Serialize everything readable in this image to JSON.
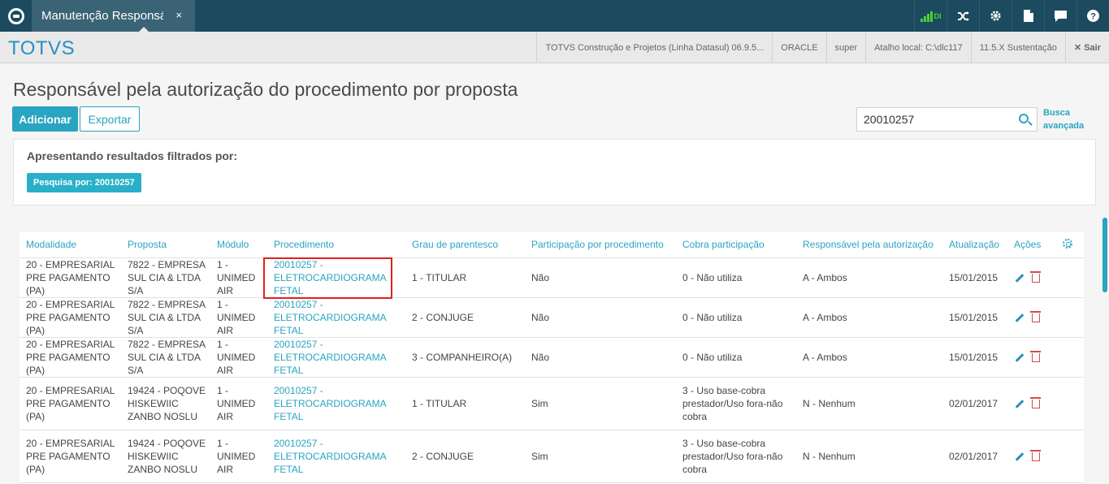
{
  "topbar": {
    "tab_label": "Manutenção Responsá",
    "tab_close": "×",
    "signal_label": "DI"
  },
  "header": {
    "brand": "TOTVS",
    "items": [
      "TOTVS Construção e Projetos (Linha Datasul) 06.9.5...",
      "ORACLE",
      "super",
      "Atalho local: C:\\dlc117",
      "11.5.X Sustentação"
    ],
    "logout": "✕ Sair"
  },
  "page": {
    "title": "Responsável pela autorização do procedimento por proposta",
    "add_label": "Adicionar",
    "export_label": "Exportar",
    "search_value": "20010257",
    "adv_search_line1": "Busca",
    "adv_search_line2": "avançada"
  },
  "filter": {
    "title": "Apresentando resultados filtrados por:",
    "chip": "Pesquisa por: 20010257"
  },
  "table": {
    "headers": [
      "Modalidade",
      "Proposta",
      "Módulo",
      "Procedimento",
      "Grau de parentesco",
      "Participação por procedimento",
      "Cobra participação",
      "Responsável pela autorização",
      "Atualização",
      "Ações"
    ],
    "rows": [
      {
        "modalidade": "20 - EMPRESARIAL PRE PAGAMENTO (PA)",
        "proposta": "7822 - EMPRESA SUL CIA & LTDA S/A",
        "modulo": "1 - UNIMED AIR",
        "procedimento": "20010257 - ELETROCARDIOGRAMA FETAL",
        "grau": "1 - TITULAR",
        "participacao": "Não",
        "cobra": "0 - Não utiliza",
        "responsavel": "A - Ambos",
        "atualizacao": "15/01/2015"
      },
      {
        "modalidade": "20 - EMPRESARIAL PRE PAGAMENTO (PA)",
        "proposta": "7822 - EMPRESA SUL CIA & LTDA S/A",
        "modulo": "1 - UNIMED AIR",
        "procedimento": "20010257 - ELETROCARDIOGRAMA FETAL",
        "grau": "2 - CONJUGE",
        "participacao": "Não",
        "cobra": "0 - Não utiliza",
        "responsavel": "A - Ambos",
        "atualizacao": "15/01/2015"
      },
      {
        "modalidade": "20 - EMPRESARIAL PRE PAGAMENTO (PA)",
        "proposta": "7822 - EMPRESA SUL CIA & LTDA S/A",
        "modulo": "1 - UNIMED AIR",
        "procedimento": "20010257 - ELETROCARDIOGRAMA FETAL",
        "grau": "3 - COMPANHEIRO(A)",
        "participacao": "Não",
        "cobra": "0 - Não utiliza",
        "responsavel": "A - Ambos",
        "atualizacao": "15/01/2015"
      },
      {
        "modalidade": "20 - EMPRESARIAL PRE PAGAMENTO (PA)",
        "proposta": "19424 - POQOVE HISKEWIIC ZANBO NOSLU",
        "modulo": "1 - UNIMED AIR",
        "procedimento": "20010257 - ELETROCARDIOGRAMA FETAL",
        "grau": "1 - TITULAR",
        "participacao": "Sim",
        "cobra": "3 - Uso base-cobra prestador/Uso fora-não cobra",
        "responsavel": "N - Nenhum",
        "atualizacao": "02/01/2017"
      },
      {
        "modalidade": "20 - EMPRESARIAL PRE PAGAMENTO (PA)",
        "proposta": "19424 - POQOVE HISKEWIIC ZANBO NOSLU",
        "modulo": "1 - UNIMED AIR",
        "procedimento": "20010257 - ELETROCARDIOGRAMA FETAL",
        "grau": "2 - CONJUGE",
        "participacao": "Sim",
        "cobra": "3 - Uso base-cobra prestador/Uso fora-não cobra",
        "responsavel": "N - Nenhum",
        "atualizacao": "02/01/2017"
      }
    ]
  },
  "colors": {
    "topbar": "#1c4a5e",
    "accent": "#29a4c1",
    "brand": "#2a8fc0",
    "delete": "#d24b4b",
    "highlight": "#e02020"
  },
  "icons": [
    "app-logo-icon",
    "signal-icon",
    "shuffle-icon",
    "gear-icon",
    "document-icon",
    "chat-icon",
    "help-icon",
    "search-icon",
    "edit-icon",
    "trash-icon",
    "settings-gear-icon"
  ]
}
